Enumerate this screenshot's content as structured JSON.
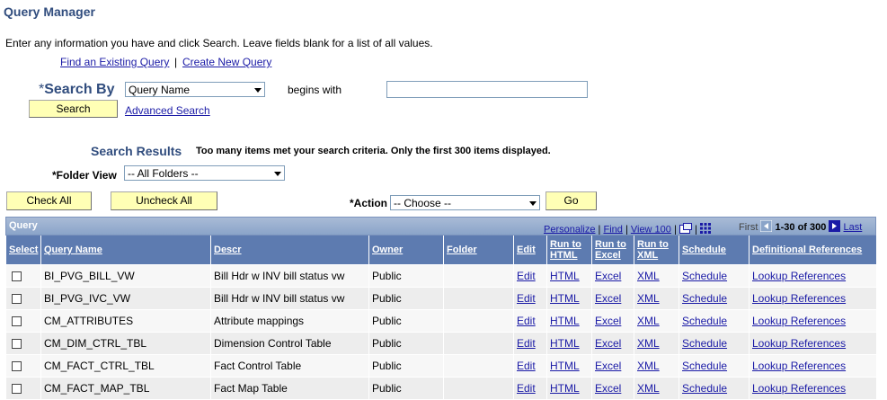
{
  "page": {
    "title": "Query Manager",
    "instructions": "Enter any information you have and click Search. Leave fields blank for a list of all values.",
    "find_existing_label": "Find an Existing Query",
    "separator": "|",
    "create_new_label": "Create New Query"
  },
  "search": {
    "required_mark": "*",
    "search_by_label": "Search By",
    "search_by_value": "Query Name",
    "operator_label": "begins with",
    "search_text_value": "",
    "search_button_label": "Search",
    "advanced_search_label": "Advanced Search"
  },
  "results": {
    "title": "Search Results",
    "message": "Too many items met your search criteria. Only the first 300 items displayed.",
    "folder_view_label": "*Folder View",
    "folder_view_value": "-- All Folders --",
    "check_all_label": "Check All",
    "uncheck_all_label": "Uncheck All",
    "action_label": "*Action",
    "action_value": "-- Choose --",
    "go_label": "Go"
  },
  "grid": {
    "title": "Query",
    "nav": {
      "personalize": "Personalize",
      "find": "Find",
      "view": "View 100",
      "pipe": "|",
      "first": "First",
      "range": "1-30 of 300",
      "last": "Last"
    },
    "columns": {
      "select": "Select",
      "query_name": "Query Name",
      "descr": "Descr",
      "owner": "Owner",
      "folder": "Folder",
      "edit": "Edit",
      "run_html": "Run to HTML",
      "run_excel": "Run to Excel",
      "run_xml": "Run to XML",
      "schedule": "Schedule",
      "def_refs": "Definitional References"
    },
    "rows": [
      {
        "name": "BI_PVG_BILL_VW",
        "descr": "Bill Hdr w INV bill status vw",
        "owner": "Public",
        "folder": "",
        "edit": "Edit",
        "html": "HTML",
        "excel": "Excel",
        "xml": "XML",
        "schedule": "Schedule",
        "refs": "Lookup References"
      },
      {
        "name": "BI_PVG_IVC_VW",
        "descr": "Bill Hdr w INV bill status vw",
        "owner": "Public",
        "folder": "",
        "edit": "Edit",
        "html": "HTML",
        "excel": "Excel",
        "xml": "XML",
        "schedule": "Schedule",
        "refs": "Lookup References"
      },
      {
        "name": "CM_ATTRIBUTES",
        "descr": "Attribute mappings",
        "owner": "Public",
        "folder": "",
        "edit": "Edit",
        "html": "HTML",
        "excel": "Excel",
        "xml": "XML",
        "schedule": "Schedule",
        "refs": "Lookup References"
      },
      {
        "name": "CM_DIM_CTRL_TBL",
        "descr": "Dimension Control Table",
        "owner": "Public",
        "folder": "",
        "edit": "Edit",
        "html": "HTML",
        "excel": "Excel",
        "xml": "XML",
        "schedule": "Schedule",
        "refs": "Lookup References"
      },
      {
        "name": "CM_FACT_CTRL_TBL",
        "descr": "Fact Control Table",
        "owner": "Public",
        "folder": "",
        "edit": "Edit",
        "html": "HTML",
        "excel": "Excel",
        "xml": "XML",
        "schedule": "Schedule",
        "refs": "Lookup References"
      },
      {
        "name": "CM_FACT_MAP_TBL",
        "descr": "Fact Map Table",
        "owner": "Public",
        "folder": "",
        "edit": "Edit",
        "html": "HTML",
        "excel": "Excel",
        "xml": "XML",
        "schedule": "Schedule",
        "refs": "Lookup References"
      }
    ]
  },
  "colors": {
    "title_blue": "#314d7e",
    "link_blue": "#1a1aa6",
    "button_yellow": "#ffffb5",
    "header_blue": "#5d7bb0"
  },
  "icons": {
    "download": "download-icon",
    "grid_view": "grid-view-icon",
    "prev": "previous-arrow-icon",
    "next": "next-arrow-icon",
    "dropdown": "chevron-down-icon"
  }
}
